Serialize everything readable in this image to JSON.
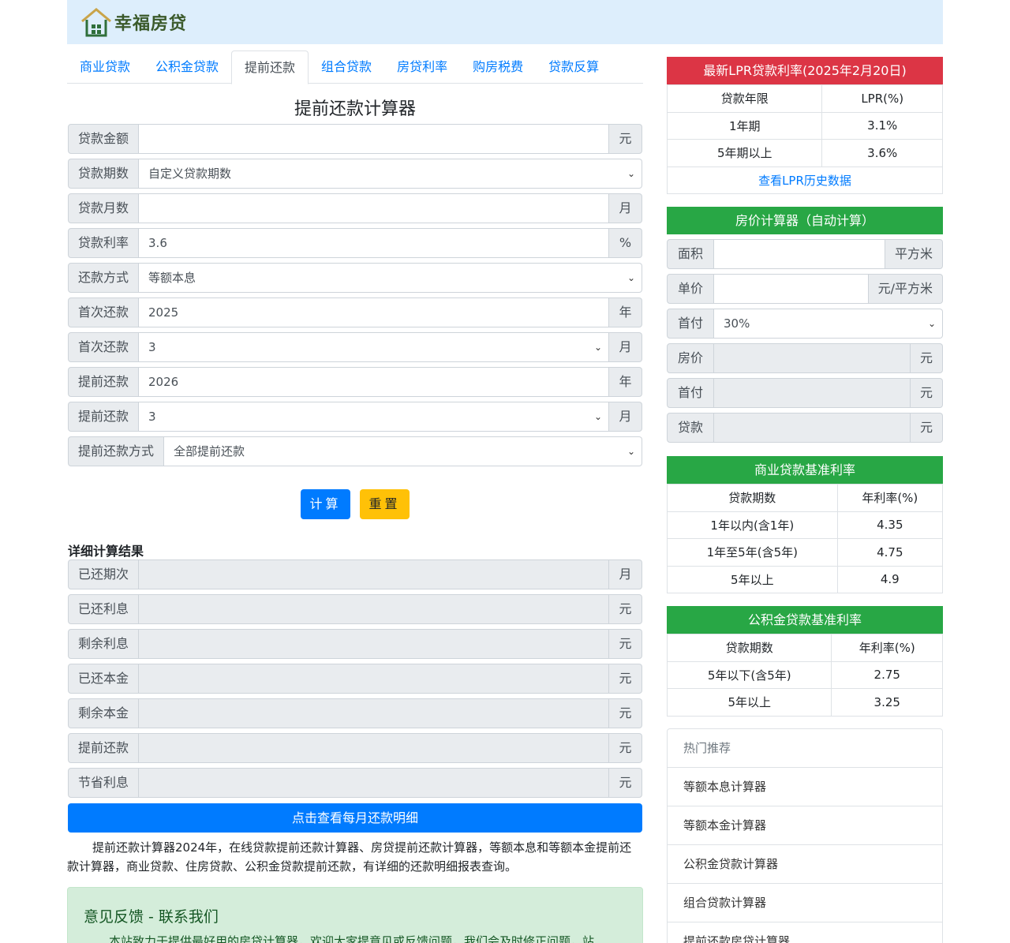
{
  "brand": {
    "name": "幸福房贷"
  },
  "tabs": [
    {
      "label": "商业贷款",
      "active": false
    },
    {
      "label": "公积金贷款",
      "active": false
    },
    {
      "label": "提前还款",
      "active": true
    },
    {
      "label": "组合贷款",
      "active": false
    },
    {
      "label": "房贷利率",
      "active": false
    },
    {
      "label": "购房税费",
      "active": false
    },
    {
      "label": "贷款反算",
      "active": false
    }
  ],
  "calculator": {
    "title": "提前还款计算器",
    "fields": [
      {
        "label": "贷款金额",
        "value": "",
        "unit": "元",
        "type": "input"
      },
      {
        "label": "贷款期数",
        "value": "自定义贷款期数",
        "unit": "",
        "type": "select"
      },
      {
        "label": "贷款月数",
        "value": "",
        "unit": "月",
        "type": "input"
      },
      {
        "label": "贷款利率",
        "value": "3.6",
        "unit": "%",
        "type": "input"
      },
      {
        "label": "还款方式",
        "value": "等额本息",
        "unit": "",
        "type": "select"
      },
      {
        "label": "首次还款",
        "value": "2025",
        "unit": "年",
        "type": "input"
      },
      {
        "label": "首次还款",
        "value": "3",
        "unit": "月",
        "type": "select"
      },
      {
        "label": "提前还款",
        "value": "2026",
        "unit": "年",
        "type": "input"
      },
      {
        "label": "提前还款",
        "value": "3",
        "unit": "月",
        "type": "select"
      },
      {
        "label": "提前还款方式",
        "value": "全部提前还款",
        "unit": "",
        "type": "select"
      }
    ],
    "calc_button": "计算",
    "reset_button": "重置"
  },
  "results": {
    "title": "详细计算结果",
    "fields": [
      {
        "label": "已还期次",
        "value": "",
        "unit": "月"
      },
      {
        "label": "已还利息",
        "value": "",
        "unit": "元"
      },
      {
        "label": "剩余利息",
        "value": "",
        "unit": "元"
      },
      {
        "label": "已还本金",
        "value": "",
        "unit": "元"
      },
      {
        "label": "剩余本金",
        "value": "",
        "unit": "元"
      },
      {
        "label": "提前还款",
        "value": "",
        "unit": "元"
      },
      {
        "label": "节省利息",
        "value": "",
        "unit": "元"
      }
    ],
    "detail_button": "点击查看每月还款明细"
  },
  "description": "提前还款计算器2024年，在线贷款提前还款计算器、房贷提前还款计算器，等额本息和等额本金提前还款计算器，商业贷款、住房贷款、公积金贷款提前还款，有详细的还款明细报表查询。",
  "feedback": {
    "title": "意见反馈 - 联系我们",
    "text": "本站致力于提供最好用的房贷计算器，欢迎大家提意见或反馈问题，我们会及时修正问题，站"
  },
  "lpr": {
    "title": "最新LPR贷款利率(2025年2月20日)",
    "header": [
      "贷款年限",
      "LPR(%)"
    ],
    "rows": [
      [
        "1年期",
        "3.1%"
      ],
      [
        "5年期以上",
        "3.6%"
      ]
    ],
    "link": "查看LPR历史数据"
  },
  "price_calc": {
    "title": "房价计算器（自动计算）",
    "fields": [
      {
        "label": "面积",
        "value": "",
        "unit": "平方米",
        "type": "input"
      },
      {
        "label": "单价",
        "value": "",
        "unit": "元/平方米",
        "type": "input"
      },
      {
        "label": "首付",
        "value": "30%",
        "unit": "",
        "type": "select"
      },
      {
        "label": "房价",
        "value": "",
        "unit": "元",
        "type": "readonly"
      },
      {
        "label": "首付",
        "value": "",
        "unit": "元",
        "type": "readonly"
      },
      {
        "label": "贷款",
        "value": "",
        "unit": "元",
        "type": "readonly"
      }
    ]
  },
  "commercial_rates": {
    "title": "商业贷款基准利率",
    "header": [
      "贷款期数",
      "年利率(%)"
    ],
    "rows": [
      [
        "1年以内(含1年)",
        "4.35"
      ],
      [
        "1年至5年(含5年)",
        "4.75"
      ],
      [
        "5年以上",
        "4.9"
      ]
    ]
  },
  "fund_rates": {
    "title": "公积金贷款基准利率",
    "header": [
      "贷款期数",
      "年利率(%)"
    ],
    "rows": [
      [
        "5年以下(含5年)",
        "2.75"
      ],
      [
        "5年以上",
        "3.25"
      ]
    ]
  },
  "recommend": {
    "title": "热门推荐",
    "items": [
      "等额本息计算器",
      "等额本金计算器",
      "公积金贷款计算器",
      "组合贷款计算器",
      "提前还款房贷计算器"
    ]
  },
  "colors": {
    "primary": "#007bff",
    "warning": "#ffc107",
    "danger": "#dc3545",
    "success": "#28a745",
    "header_bg": "#ddeefc"
  }
}
